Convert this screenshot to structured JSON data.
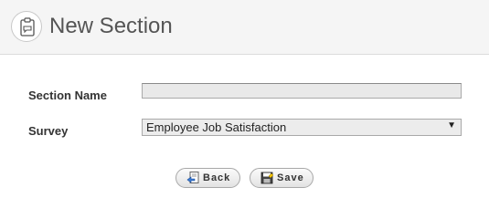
{
  "header": {
    "title": "New Section",
    "icon": "clipboard-icon"
  },
  "form": {
    "section_name": {
      "label": "Section Name",
      "value": ""
    },
    "survey": {
      "label": "Survey",
      "selected": "Employee Job Satisfaction"
    }
  },
  "buttons": {
    "back": {
      "label": "Back",
      "icon": "back-page-icon"
    },
    "save": {
      "label": "Save",
      "icon": "floppy-disk-icon"
    }
  },
  "colors": {
    "header_bg": "#f5f5f5",
    "title_text": "#555555",
    "input_bg": "#e9e9e9"
  }
}
